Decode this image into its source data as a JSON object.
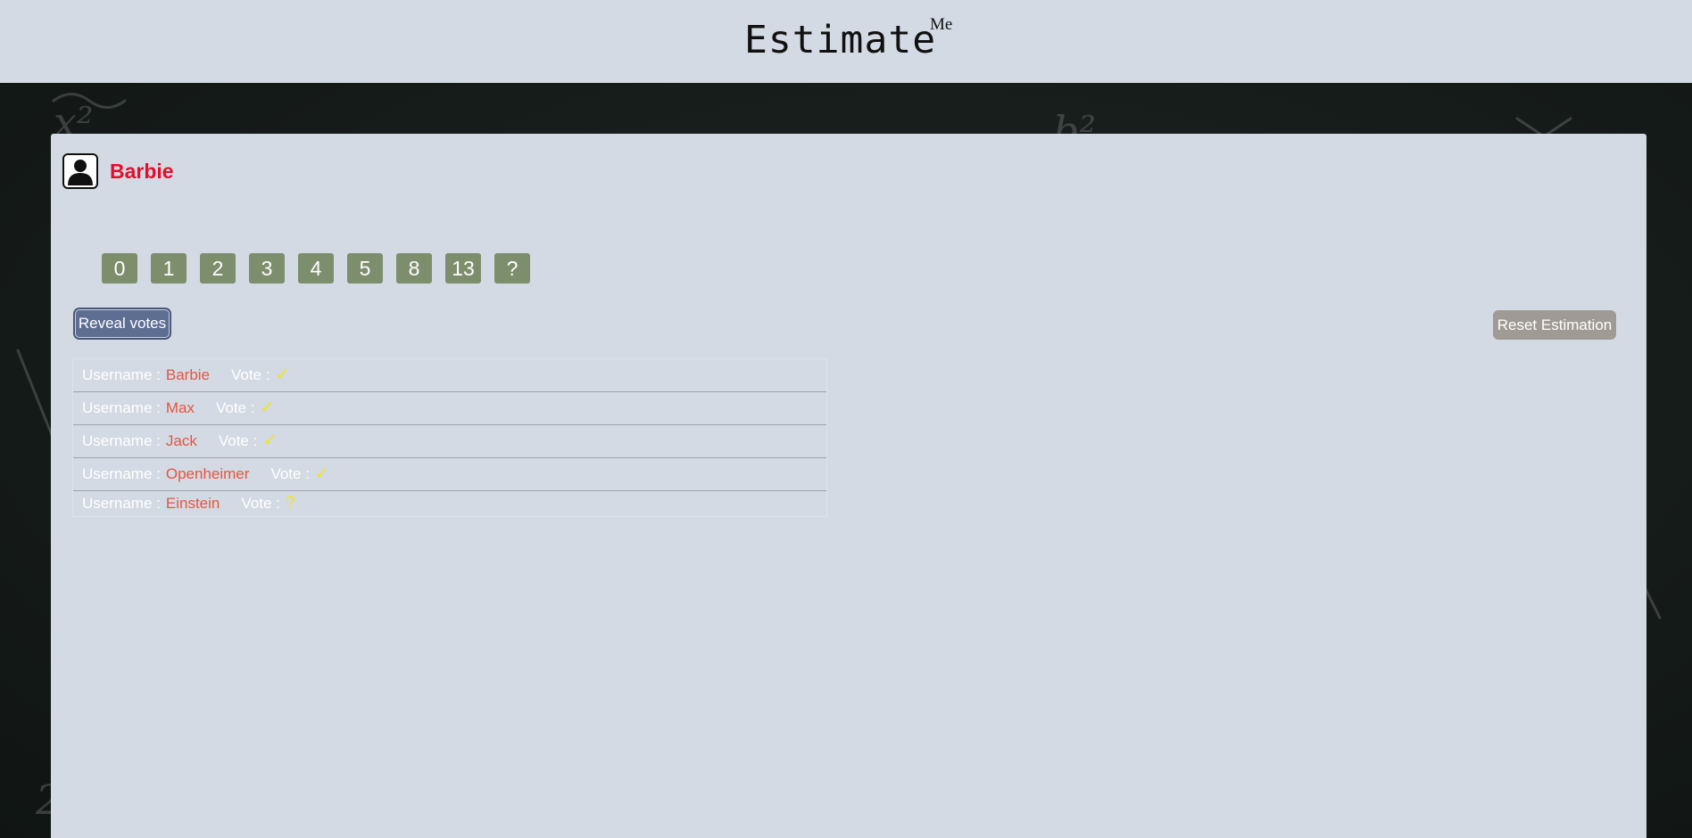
{
  "header": {
    "title": "Estimate",
    "title_superscript": "Me"
  },
  "user": {
    "name": "Barbie",
    "avatar_icon": "user-silhouette-icon"
  },
  "cards": [
    "0",
    "1",
    "2",
    "3",
    "4",
    "5",
    "8",
    "13",
    "?"
  ],
  "actions": {
    "reveal_label": "Reveal votes",
    "reset_label": "Reset Estimation"
  },
  "votes": {
    "username_label": "Username :",
    "vote_label": "Vote :",
    "rows": [
      {
        "username": "Barbie",
        "vote": "✓"
      },
      {
        "username": "Max",
        "vote": "✓"
      },
      {
        "username": "Jack",
        "vote": "✓"
      },
      {
        "username": "Openheimer",
        "vote": "✓"
      },
      {
        "username": "Einstein",
        "vote": "?"
      }
    ]
  },
  "colors": {
    "header_bg": "#d3dae4",
    "username_accent": "#e0102c",
    "card_bg": "#7d8e6c",
    "reveal_bg": "#5e6e93",
    "reset_bg": "#a09a94",
    "vote_name": "#e8553e",
    "vote_mark": "#f2e51a"
  }
}
